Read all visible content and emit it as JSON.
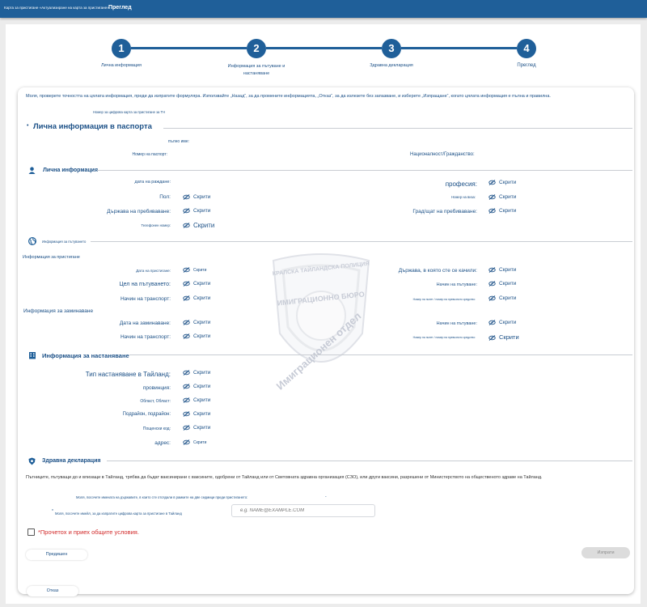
{
  "header": {
    "breadcrumb": "Карта за пристигане «Актуализиране на карта за пристигане»",
    "current": "Преглед"
  },
  "steps": [
    {
      "number": "1",
      "label": "Лична информация"
    },
    {
      "number": "2",
      "label": "Информация за пътуване и настаняване"
    },
    {
      "number": "3",
      "label": "Здравна декларация"
    },
    {
      "number": "4",
      "label": "Преглед"
    }
  ],
  "intro": "Моля, проверете точността на цялата информация, преди да изпратите формуляра. Използвайте „Назад“, за да промените информацията, „Отказ“, за да излезете без запазване, и изберете „Изпращане“, когато цялата информация е пълна и правилна.",
  "tdac_number_label": "Номер за цифрова карта за пристигане за ТН",
  "hidden_text": "Скрити",
  "watermark": {
    "line1": "КРАЛСКА ТАЙЛАНДСКА ПОЛИЦИЯ",
    "line2": "ИМИГРАЦИОННО БЮРО",
    "line3": "Имиграционен отдел"
  },
  "passport": {
    "title": "Лична информация в паспорта",
    "full_name": "пълно име:",
    "passport_no": "Номер на паспорт:",
    "nationality": "Националност/Гражданство:"
  },
  "personal": {
    "title": "Лична информация",
    "dob": "дата на раждане:",
    "occupation": "професия:",
    "gender": "Пол:",
    "visa_no": "Номер на виза:",
    "residence_country": "Държава на пребиваване:",
    "residence_city": "Град/щат на пребиваване:",
    "phone": "Телефонен номер:"
  },
  "travel": {
    "title": "Информация за пътуването",
    "arrival_title": "Информация за пристигане",
    "arrival_date": "Дата на пристигане:",
    "boarded_country": "Държава, в която сте се качили:",
    "purpose": "Цел на пътуването:",
    "arrival_mode": "Начин на пътуване:",
    "arrival_transport": "Начин на транспорт:",
    "flight_no": "Номер на полет / номер на превозното средство:",
    "departure_title": "Информация за заминаване",
    "departure_date": "Дата на заминаване:",
    "departure_mode": "Начин на пътуване:",
    "departure_transport": "Начин на транспорт:",
    "departure_flight_no": "Номер на полет / номер на превозното средство:"
  },
  "accommodation": {
    "title": "Информация за настаняване",
    "type": "Тип настаняване в Тайланд:",
    "province": "провинция:",
    "district": "Област, Област:",
    "subdistrict": "Подрайон, подрайон:",
    "postcode": "Пощенски код:",
    "address": "адрес:"
  },
  "health": {
    "title": "Здравна декларация",
    "text": "Пътниците, пътуващи до и влизащи в Тайланд, трябва да бъдат ваксинирани с ваксините, одобрени от Тайланд или от Световната здравна организация (СЗО), или други ваксини, разрешени от Министерството на общественото здраве на Тайланд.",
    "countries_label": "Моля, посочете имената на държавите, в които сте отсядали в рамките на две седмици преди пристигането:",
    "countries_value": "-",
    "email_label": "Моля, посочете имейл, за да изпратите цифрова карта за пристигане в Тайланд",
    "email_placeholder": "e.g. NAME@EXAMPLE.COM",
    "terms": "*Прочетох и приех общите условия."
  },
  "buttons": {
    "back": "Предишен",
    "submit": "Изпрати",
    "cancel": "Отказ"
  }
}
